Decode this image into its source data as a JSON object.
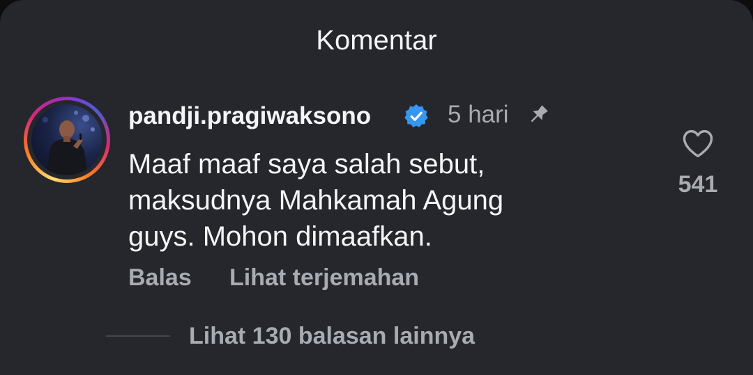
{
  "header": {
    "title": "Komentar"
  },
  "comment": {
    "username": "pandji.pragiwaksono",
    "verified": true,
    "time": "5 hari",
    "pinned": true,
    "text_lines": [
      "Maaf maaf saya salah sebut,",
      "maksudnya Mahkamah Agung",
      "guys. Mohon dimaafkan."
    ],
    "reply_label": "Balas",
    "translate_label": "Lihat terjemahan",
    "like_count": "541"
  },
  "replies": {
    "view_more_label": "Lihat 130 balasan lainnya"
  },
  "icons": {
    "verified": "verified-badge-icon",
    "pin": "pin-icon",
    "like": "heart-outline-icon"
  },
  "colors": {
    "background": "#25272c",
    "primary_text": "#f3f5f7",
    "secondary_text": "#a8acb2",
    "verified_blue": "#3797f0"
  }
}
